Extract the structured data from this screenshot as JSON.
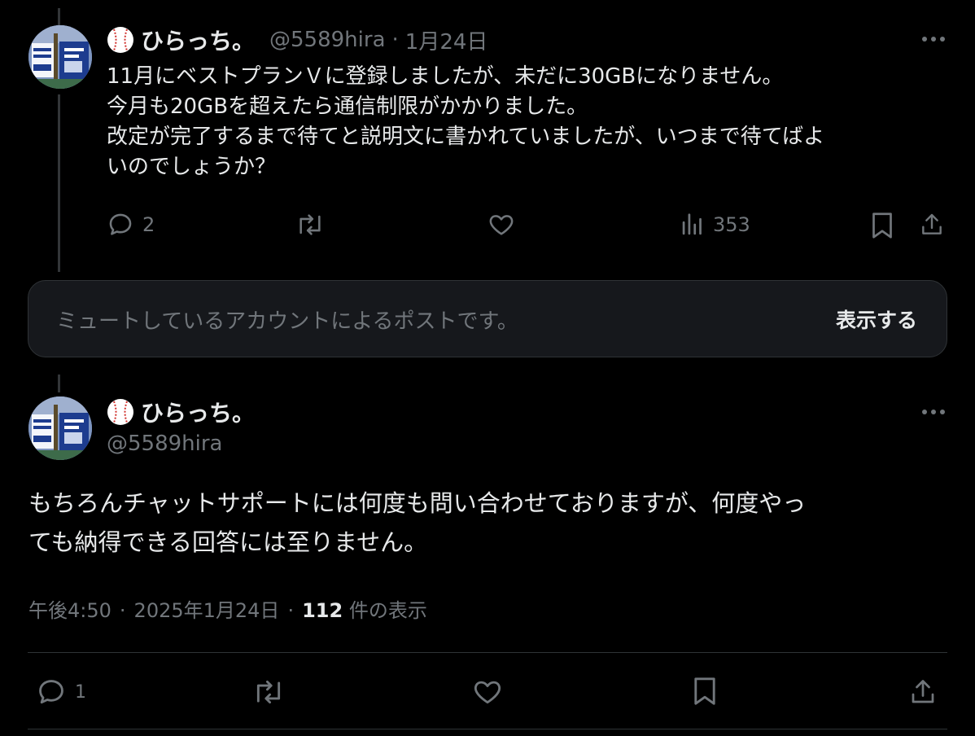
{
  "post1": {
    "display_name": "ひらっち。",
    "handle": "@5589hira",
    "separator": "·",
    "date": "1月24日",
    "lines": [
      "11月にベストプランＶに登録しましたが、未だに30GBになりません。",
      "今月も20GBを超えたら通信制限がかかりました。",
      "改定が完了するまで待てと説明文に書かれていましたが、いつまで待てばよ",
      "いのでしょうか？"
    ],
    "replies": "2",
    "views": "353"
  },
  "muted": {
    "text": "ミュートしているアカウントによるポストです。",
    "show_label": "表示する"
  },
  "post2": {
    "display_name": "ひらっち。",
    "handle": "@5589hira",
    "lines": [
      "もちろんチャットサポートには何度も問い合わせておりますが、何度やっ",
      "ても納得できる回答には至りません。"
    ],
    "time": "午後4:50",
    "separator": "·",
    "date": "2025年1月24日",
    "views_count": "112",
    "views_label": "件の表示",
    "replies": "1"
  },
  "icons": {
    "avatar": "avatar-image",
    "badge": "baseball-icon",
    "reply": "reply-icon",
    "retweet": "retweet-icon",
    "like": "heart-icon",
    "views": "views-icon",
    "bookmark": "bookmark-icon",
    "share": "share-icon",
    "more": "more-icon"
  },
  "colors": {
    "background": "#000000",
    "text": "#e7e9ea",
    "muted": "#71767b",
    "divider": "#2f3336"
  }
}
